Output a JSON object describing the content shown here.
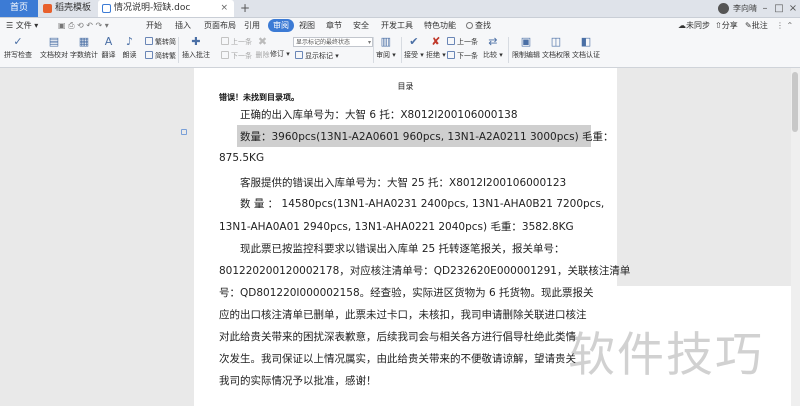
{
  "tabs": [
    {
      "label": "首页"
    },
    {
      "label": "稻壳模板"
    },
    {
      "label": "情况说明-短缺.doc"
    }
  ],
  "window": {
    "user_name": "李向晴",
    "add_tab": "+",
    "close_glyph": "×"
  },
  "menu": {
    "file_label": "文件",
    "items": [
      "开始",
      "插入",
      "页面布局",
      "引用",
      "审阅",
      "视图",
      "章节",
      "安全",
      "开发工具",
      "特色功能"
    ],
    "active": "审阅",
    "search_label": "查找",
    "sync_label": "未同步",
    "share_label": "分享",
    "comment_label": "批注"
  },
  "toolbar": {
    "spellcheck": "拼写检查",
    "doc_proof": "文档校对",
    "word_count": "字数统计",
    "translate": "翻译",
    "read_aloud": "朗读",
    "trad_simp": "繁转简",
    "simp_trad": "简转繁",
    "insert_comment": "插入批注",
    "prev_comment": "上一条",
    "next_comment": "下一条",
    "delete_comment": "删除",
    "revision": "修订",
    "markup_state": "显示标记的最终状态",
    "show_markup": "显示标记",
    "review": "审阅",
    "accept": "接受",
    "reject": "拒绝",
    "prev_change": "上一条",
    "next_change": "下一条",
    "compare": "比较",
    "restrict_edit": "限制编辑",
    "doc_permission": "文档权限",
    "doc_cert": "文档认证"
  },
  "document": {
    "heading": "目录",
    "toc_error": "错误！未找到目录项。",
    "lines": [
      "正确的出入库单号为：大智 6 托：X8012I200106000138",
      "数量：3960pcs(13N1-A2A0601 960pcs, 13N1-A2A0211 3000pcs)     毛重：",
      "875.5KG",
      "客服提供的错误出入库单号为：大智 25 托：X8012I200106000123",
      "数  量  ：  14580pcs(13N1-AHA0231   2400pcs,   13N1-AHA0B21   7200pcs,",
      "13N1-AHA0A01 2940pcs, 13N1-AHA0221 2040pcs)        毛重：3582.8KG",
      "现此票已按监控科要求以错误出入库单 25 托转逐笔报关，报关单号：",
      "801220200120002178，对应核注清单号：QD232620E000001291，关联核注清单",
      "号：QD801220I000002158。经查验，实际进区货物为 6 托货物。现此票报关",
      "应的出口核注清单已删单，此票未过卡口，未核扣，我司申请删除关联进口核注",
      "对此给贵关带来的困扰深表歉意，后续我司会与相关各方进行倡导杜绝此类情",
      "次发生。我司保证以上情况属实，由此给贵关带来的不便敬请谅解，望请贵关",
      "我司的实际情况予以批准，感谢！"
    ]
  },
  "watermark": "软件技巧"
}
